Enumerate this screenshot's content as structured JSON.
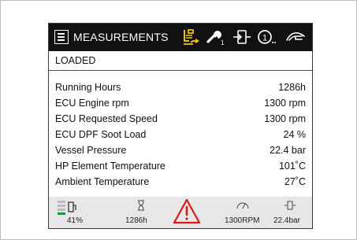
{
  "header": {
    "title": "MEASUREMENTS",
    "icons": [
      "menu-icon",
      "compressor-loading-icon",
      "service-wrench-icon",
      "transfer-icon",
      "timer-one-icon",
      "hand-icon"
    ],
    "service_subscript": "1",
    "accent_color": "#f2c200"
  },
  "status": {
    "label": "LOADED"
  },
  "measurements": [
    {
      "label": "Running Hours",
      "value": "1286h"
    },
    {
      "label": "ECU Engine rpm",
      "value": "1300 rpm"
    },
    {
      "label": "ECU Requested Speed",
      "value": "1300 rpm"
    },
    {
      "label": "ECU DPF Soot Load",
      "value": "24 %"
    },
    {
      "label": "Vessel Pressure",
      "value": "22.4 bar"
    },
    {
      "label": "HP Element Temperature",
      "value": "101˚C"
    },
    {
      "label": "Ambient Temperature",
      "value": "27˚C"
    }
  ],
  "footer": {
    "fuel": {
      "icon": "fuel-gauge-icon",
      "value": "41%",
      "level": 0.41,
      "color": "#1a9a3a"
    },
    "hours": {
      "icon": "hourglass-icon",
      "value": "1286h"
    },
    "warning": {
      "icon": "warning-triangle-icon",
      "color": "#d91a1a"
    },
    "rpm": {
      "icon": "speedometer-icon",
      "value": "1300RPM"
    },
    "pressure": {
      "icon": "pressure-icon",
      "value": "22.4bar"
    }
  }
}
